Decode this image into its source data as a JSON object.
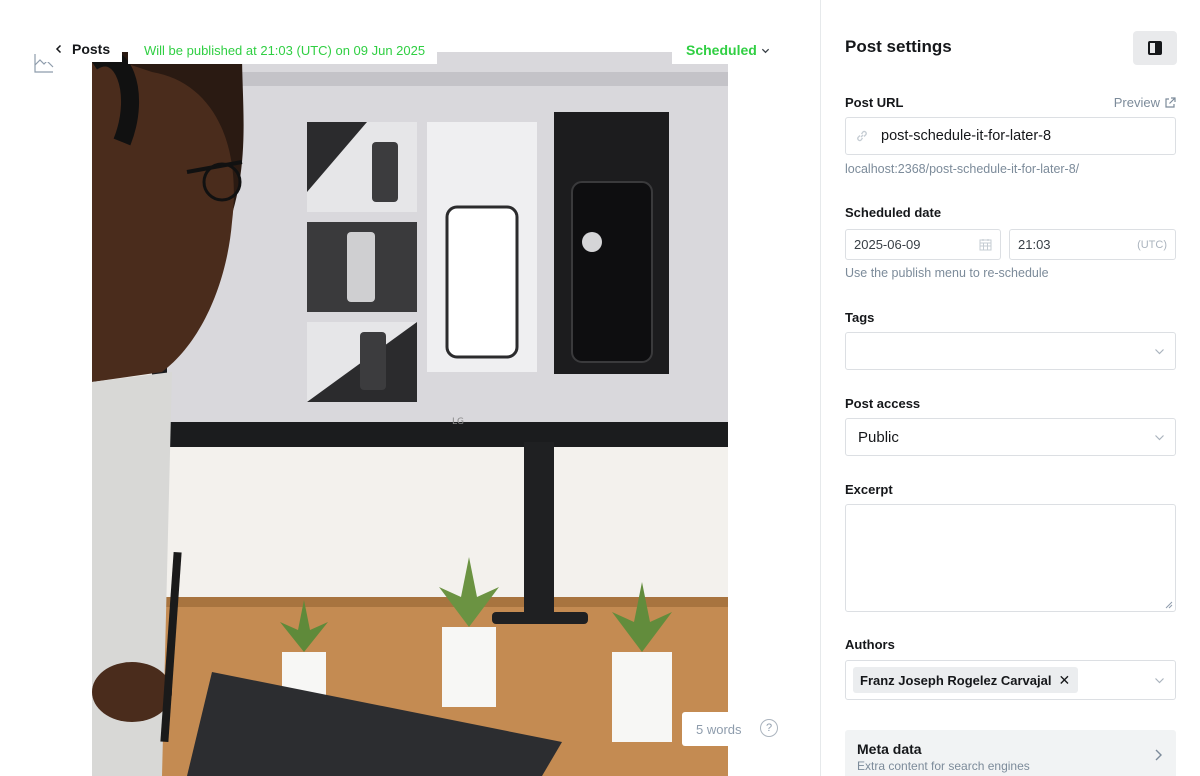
{
  "editor": {
    "back_label": "Posts",
    "publish_status": "Will be published at 21:03 (UTC) on 09 Jun 2025",
    "post_state": "Scheduled",
    "word_count": "5 words",
    "help_label": "?"
  },
  "panel": {
    "title": "Post settings",
    "post_url": {
      "label": "Post URL",
      "preview_label": "Preview",
      "value": "post-schedule-it-for-later-8",
      "full_url": "localhost:2368/post-schedule-it-for-later-8/"
    },
    "scheduled_date": {
      "label": "Scheduled date",
      "date": "2025-06-09",
      "time": "21:03",
      "timezone": "(UTC)",
      "hint": "Use the publish menu to re-schedule"
    },
    "tags": {
      "label": "Tags",
      "value": ""
    },
    "post_access": {
      "label": "Post access",
      "value": "Public"
    },
    "excerpt": {
      "label": "Excerpt",
      "value": ""
    },
    "authors": {
      "label": "Authors",
      "items": [
        "Franz Joseph Rogelez Carvajal"
      ],
      "remove_glyph": "✕"
    },
    "meta_data": {
      "title": "Meta data",
      "subtitle": "Extra content for search engines"
    }
  },
  "colors": {
    "accent_green": "#30cf43",
    "text_dark": "#15171a",
    "muted": "#7c8b9a",
    "border": "#dcdfe3"
  },
  "icons": [
    "chevron-left-icon",
    "chevron-down-icon",
    "sidebar-toggle-icon",
    "external-link-icon",
    "link-icon",
    "calendar-icon",
    "close-icon",
    "chevron-right-icon",
    "image-icon",
    "help-icon"
  ]
}
